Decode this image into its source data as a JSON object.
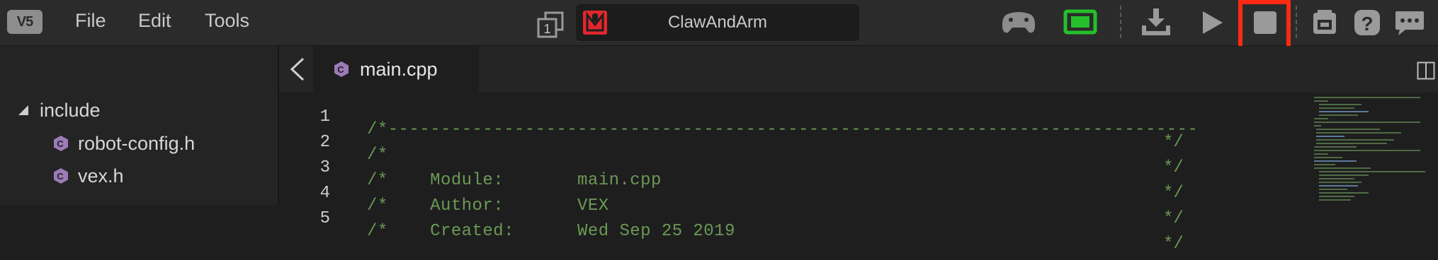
{
  "menu": {
    "logo_text": "V5",
    "items": [
      "File",
      "Edit",
      "Tools"
    ]
  },
  "project": {
    "name": "ClawAndArm",
    "slot_number": "1"
  },
  "toolbar": {
    "icons": [
      "controller-icon",
      "brain-icon",
      "download-icon",
      "play-icon",
      "stop-icon",
      "devices-icon",
      "help-icon",
      "feedback-icon"
    ],
    "highlighted": "stop-icon",
    "colors": {
      "brain": "#25c02b",
      "highlight": "#ff2a12",
      "slot": "#e2272c"
    }
  },
  "explorer": {
    "folder": "include",
    "files": [
      "robot-config.h",
      "vex.h"
    ]
  },
  "editor": {
    "tab_label": "main.cpp",
    "lines": [
      {
        "num": "1",
        "text": "/*-----------------------------------------------------------------------------",
        "end": "*/"
      },
      {
        "num": "2",
        "text": "/*",
        "end": "*/"
      },
      {
        "num": "3",
        "text": "/*    Module:       main.cpp",
        "end": "*/"
      },
      {
        "num": "4",
        "text": "/*    Author:       VEX",
        "end": "*/"
      },
      {
        "num": "5",
        "text": "/*    Created:      Wed Sep 25 2019",
        "end": "*/"
      }
    ]
  }
}
